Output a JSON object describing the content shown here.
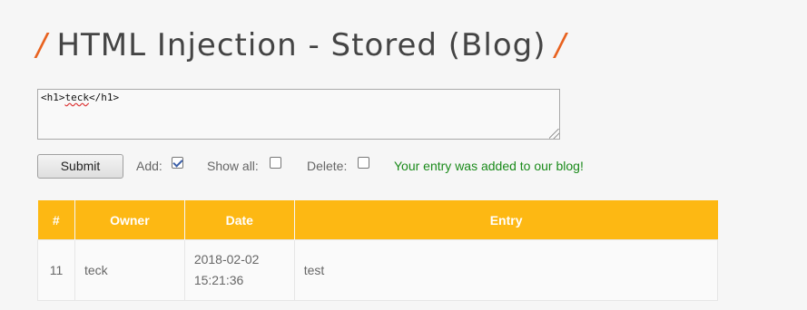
{
  "title": {
    "slash_left": "/",
    "text": "HTML Injection - Stored (Blog)",
    "slash_right": "/"
  },
  "form": {
    "textarea_value_open": "<h1>",
    "textarea_value_word": "teck",
    "textarea_value_close": "</h1>",
    "submit_label": "Submit",
    "add_label": "Add:",
    "add_checked": true,
    "show_all_label": "Show all:",
    "show_all_checked": false,
    "delete_label": "Delete:",
    "delete_checked": false,
    "status_message": "Your entry was added to our blog!"
  },
  "table": {
    "headers": [
      "#",
      "Owner",
      "Date",
      "Entry"
    ],
    "rows": [
      {
        "id": "11",
        "owner": "teck",
        "date_line1": "2018-02-02",
        "date_line2": "15:21:36",
        "entry": "test"
      }
    ]
  },
  "colors": {
    "accent": "#fdb813",
    "title_slash": "#e8621f",
    "success": "#1a8a1a"
  }
}
